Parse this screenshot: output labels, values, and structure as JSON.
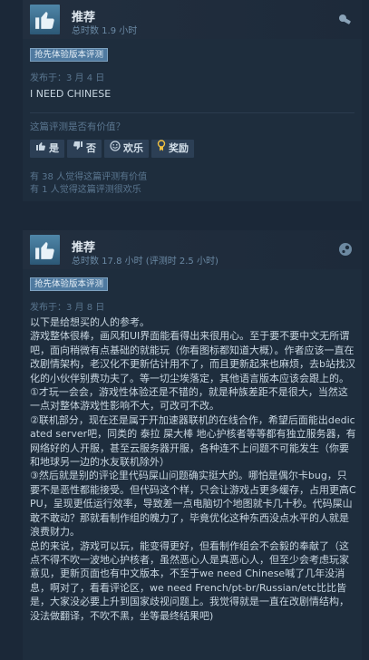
{
  "review1": {
    "verdict": "推荐",
    "hours": "总时数 1.9 小时",
    "badge": "抢先体验版本评测",
    "posted": "发布于：3 月 4 日",
    "text": "I NEED CHINESE",
    "helpful_question": "这篇评测是否有价值？",
    "buttons": {
      "yes": "是",
      "no": "否",
      "funny": "欢乐",
      "award": "奖励"
    },
    "helpful_count": "有 38 人觉得这篇评测有价值",
    "funny_count": "有 1 人觉得这篇评测很欢乐"
  },
  "review2": {
    "verdict": "推荐",
    "hours": "总时数 17.8 小时   (评测时 2.5 小时)",
    "badge": "抢先体验版本评测",
    "posted": "发布于：3 月 8 日",
    "text": "以下是给想买的人的参考。\n游戏整体很棒，画风和UI界面能看得出来很用心。至于要不要中文无所谓吧，面向稍微有点基础的就能玩（你看图标都知道大概）。作者应该一直在改剧情架构，老汉化不更新估计用不了，而且更新起来也麻烦，去b站找汉化的小伙伴别费功夫了。等一切尘埃落定，其他语言版本应该会跟上的。\n①才玩一会会，游戏性体验还是不错的，就是种族差距不是很大，当然这一点对整体游戏性影响不大，可改可不改。\n②联机部分，现在还是属于开加速器联机的在线合作，希望后面能出dedicated server吧，同类的 泰拉 屎大棒 地心护核者等等都有独立服务器，有网络好的人开服，甚至云服务器开服，各种连不上问题不可能发生（你要和地球另一边的水友联机除外）\n③然后就是别的评论里代码屎山问题确实挺大的。哪怕是偶尔卡bug，只要不是恶性都能接受。但代码这个样，只会让游戏占更多缓存，占用更高CPU，呈现更低运行效率，导致差一点电脑切个地图就卡几十秒。代码屎山敢不敢动？那就看制作组的魄力了，毕竟优化这种东西没点水平的人就是浪费财力。\n总的来说，游戏可以玩，能变得更好，但看制作组会不会毅的奉献了（这点不得不吹一波地心护核者，虽然恶心人是真恶心人，但至少会考虑玩家意见，更新页面也有中文版本，不至于we need Chinese喊了几年没消息，啊对了，看看评论区，we need French/pt-br/Russian/etc比比皆是，大家没必要上升到国家歧视问题上。我觉得就是一直在改剧情结构，没法做翻译，不吹不黑，坐等最终结果吧)"
  },
  "colors": {
    "background": "#1b2838",
    "card": "#1e2d3d",
    "accent": "#66c0f4",
    "badge": "#4f7aa0"
  },
  "icons": {
    "thumbs_up": "thumbs-up-icon",
    "thumbs_down": "thumbs-down-icon",
    "smile": "smile-icon",
    "award": "award-icon",
    "product": "product-badge-icon"
  }
}
